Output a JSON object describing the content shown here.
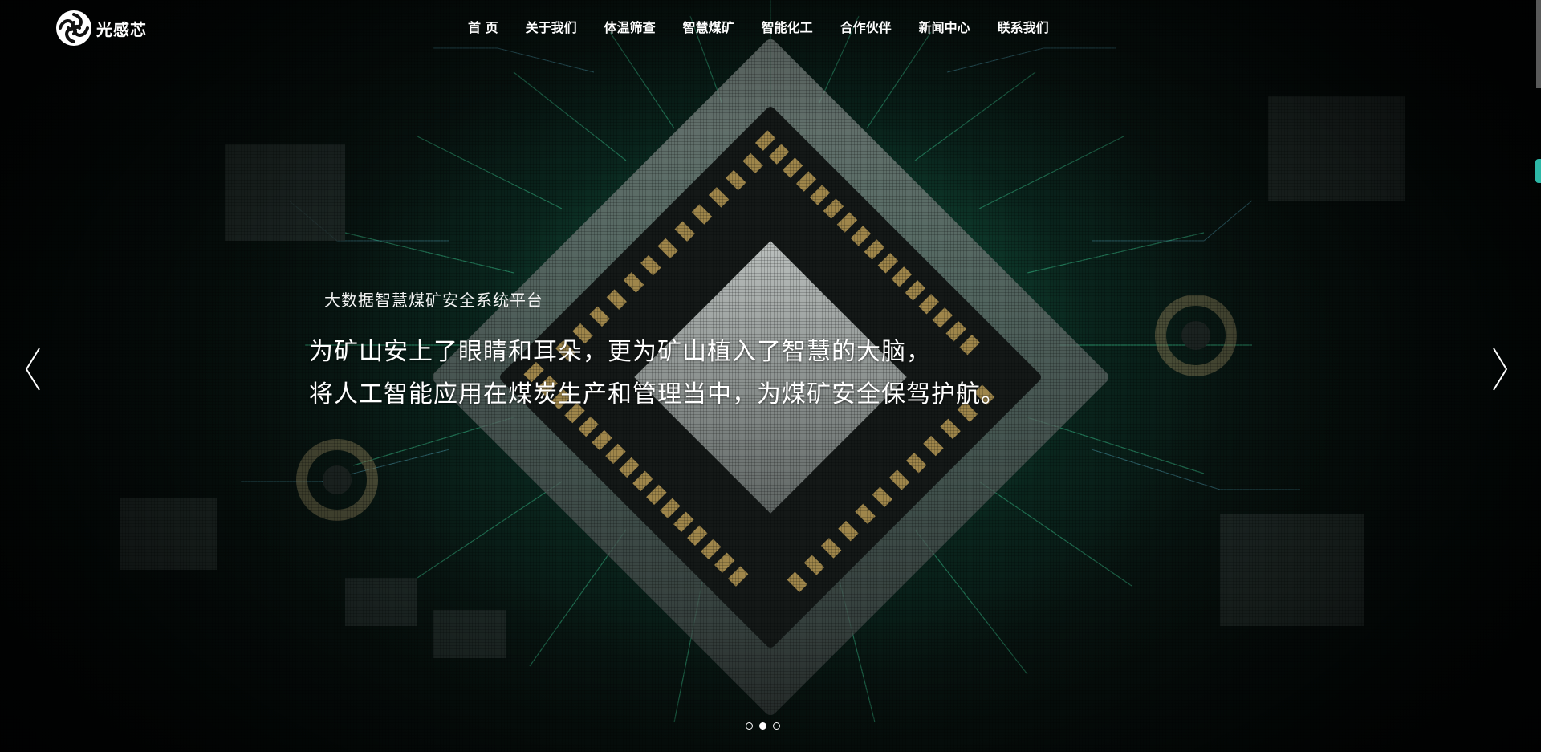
{
  "brand": {
    "logo_text": "光感芯"
  },
  "nav": {
    "items": [
      {
        "label": "首 页"
      },
      {
        "label": "关于我们"
      },
      {
        "label": "体温筛查"
      },
      {
        "label": "智慧煤矿"
      },
      {
        "label": "智能化工"
      },
      {
        "label": "合作伙伴"
      },
      {
        "label": "新闻中心"
      },
      {
        "label": "联系我们"
      }
    ]
  },
  "hero": {
    "subtitle": "大数据智慧煤矿安全系统平台",
    "line1": "为矿山安上了眼睛和耳朵，更为矿山植入了智慧的大脑，",
    "line2": "将人工智能应用在煤炭生产和管理当中，为煤矿安全保驾护航。",
    "background": "circuit-board-chip-image"
  },
  "carousel": {
    "slide_count": 3,
    "active_index": 1,
    "prev_icon": "chevron-left-icon",
    "next_icon": "chevron-right-icon"
  },
  "colors": {
    "accent": "#2db7a6",
    "text": "#ffffff",
    "glow": "#23aa78"
  }
}
